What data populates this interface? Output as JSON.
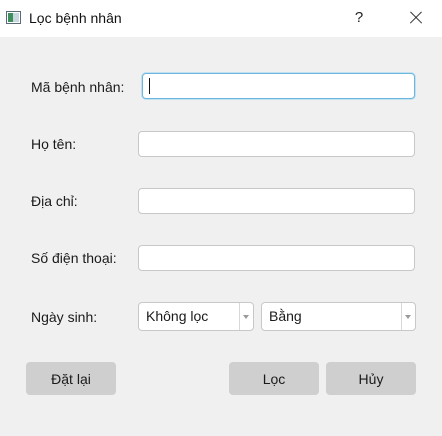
{
  "window": {
    "title": "Lọc bệnh nhân",
    "help_label": "?"
  },
  "form": {
    "patient_id": {
      "label": "Mã bệnh nhân:",
      "value": ""
    },
    "full_name": {
      "label": "Họ tên:",
      "value": ""
    },
    "address": {
      "label": "Địa chỉ:",
      "value": ""
    },
    "phone": {
      "label": "Số điện thoại:",
      "value": ""
    },
    "dob": {
      "label": "Ngày sinh:",
      "filter_mode": "Không lọc",
      "comparison": "Bằng"
    }
  },
  "buttons": {
    "reset": "Đặt lại",
    "filter": "Lọc",
    "cancel": "Hủy"
  }
}
